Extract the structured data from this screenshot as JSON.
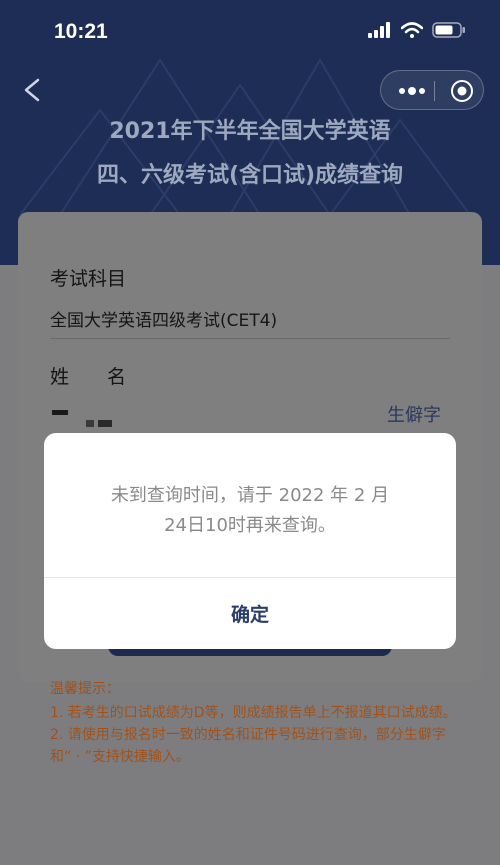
{
  "status_bar": {
    "time": "10:21",
    "icons": [
      "signal-icon",
      "wifi-icon",
      "battery-icon"
    ]
  },
  "nav": {
    "back_icon": "chevron-left-icon",
    "capsule_icons": [
      "more-icon",
      "target-icon"
    ]
  },
  "page": {
    "title_line1": "2021年下半年全国大学英语",
    "title_line2": "四、六级考试(含口试)成绩查询"
  },
  "form": {
    "subject_label": "考试科目",
    "subject_value": "全国大学英语四级考试(CET4)",
    "name_label": "姓　　名",
    "rare_char_link": "生僻字"
  },
  "dialog": {
    "message_line1": "未到查询时间，请于 2022 年 2 月",
    "message_line2": "24日10时再来查询。",
    "confirm_label": "确定"
  },
  "tips": {
    "title": "温馨提示：",
    "item1": "1. 若考生的口试成绩为D等，则成绩报告单上不报道其口试成绩。",
    "item2": "2. 请使用与报名时一致的姓名和证件号码进行查询，部分生僻字和“ · ”支持快捷输入。"
  },
  "colors": {
    "header_bg": "#1d2d55",
    "overlay": "#7d7d7f",
    "tips_text": "#a1521b",
    "link": "#28395e"
  }
}
